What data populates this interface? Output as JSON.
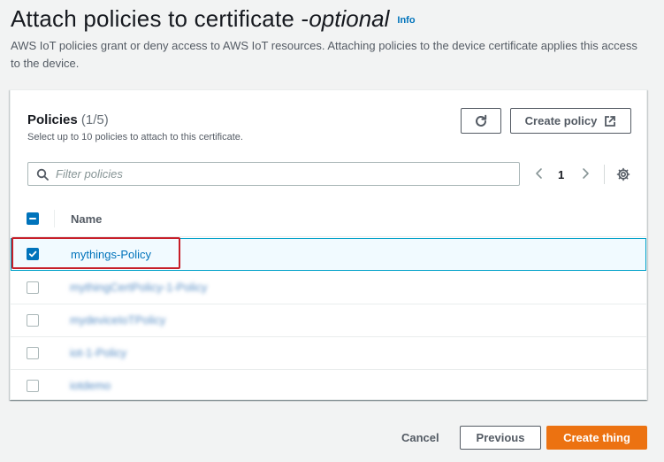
{
  "header": {
    "title": "Attach policies to certificate - ",
    "title_optional": "optional",
    "info_label": "Info",
    "description": "AWS IoT policies grant or deny access to AWS IoT resources. Attaching policies to the device certificate applies this access to the device."
  },
  "policies": {
    "title": "Policies",
    "count": "(1/5)",
    "description": "Select up to 10 policies to attach to this certificate.",
    "refresh_icon": "refresh-icon",
    "create_policy_label": "Create policy",
    "create_policy_icon": "external-link-icon",
    "filter_placeholder": "Filter policies",
    "filter_value": "",
    "page": "1",
    "column_name": "Name",
    "rows": [
      {
        "name": "mythings-Policy",
        "selected": true
      },
      {
        "name": "mythingCertPolicy-1-Policy",
        "selected": false
      },
      {
        "name": "mydeviceIoTPolicy",
        "selected": false
      },
      {
        "name": "iot-1-Policy",
        "selected": false
      },
      {
        "name": "iotdemo",
        "selected": false
      }
    ]
  },
  "footer": {
    "cancel_label": "Cancel",
    "previous_label": "Previous",
    "create_thing_label": "Create thing"
  },
  "colors": {
    "accent": "#0073bb",
    "primary_button": "#ec7211",
    "highlight_border": "#c71e28"
  }
}
